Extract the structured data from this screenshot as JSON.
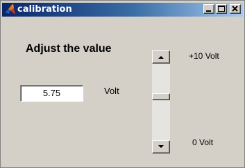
{
  "window": {
    "title": "calibration",
    "app_icon": "matlab-logo-icon",
    "controls": [
      "minimize-icon",
      "maximize-icon",
      "close-icon"
    ]
  },
  "panel": {
    "heading": "Adjust the value",
    "value": "5.75",
    "unit": "Volt",
    "scale_max_label": "+10 Volt",
    "scale_min_label": "0 Volt"
  },
  "slider": {
    "orientation": "vertical",
    "min": 0,
    "max": 10,
    "value": 5.75
  },
  "colors": {
    "window_bg": "#d4d0c8",
    "titlebar_start": "#0a246a",
    "titlebar_end": "#a6caf0",
    "title_text": "#ffffff"
  }
}
